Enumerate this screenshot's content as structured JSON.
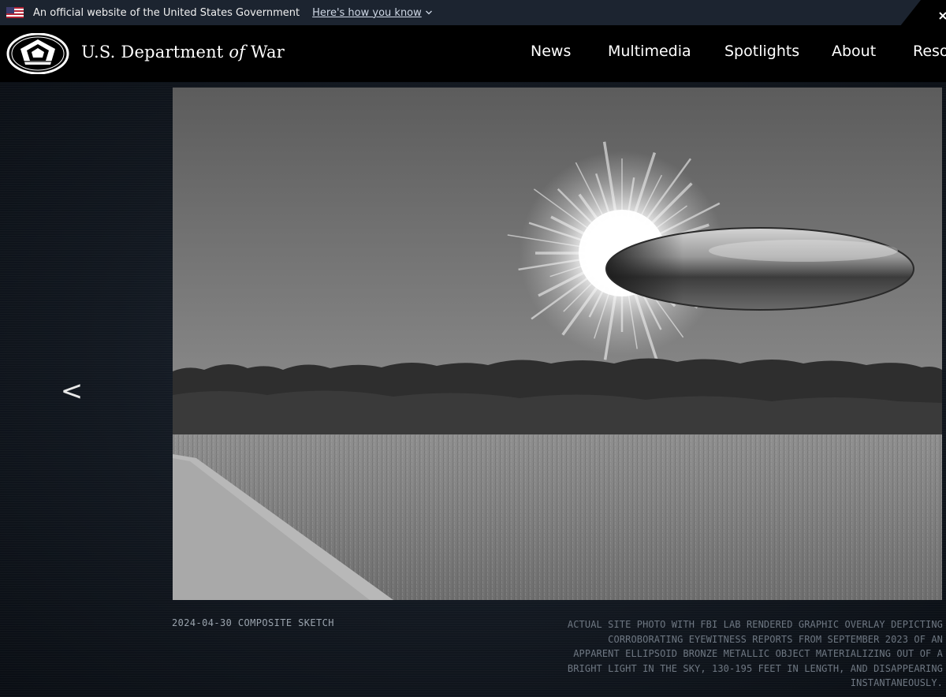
{
  "gov_banner": {
    "official_text": "An official website of the United States Government",
    "how_link": "Here's how you know",
    "flag_icon": "us-flag-icon"
  },
  "header": {
    "site_name_pre": "U.S. Department ",
    "site_name_of": "of",
    "site_name_post": " War",
    "nav": [
      {
        "label": "News"
      },
      {
        "label": "Multimedia"
      },
      {
        "label": "Spotlights"
      },
      {
        "label": "About"
      },
      {
        "label": "Resources"
      }
    ]
  },
  "gallery": {
    "prev_label": "<",
    "photo_icon": "ufo-composite-photo",
    "caption_left": "2024-04-30 COMPOSITE SKETCH",
    "caption_right": [
      "ACTUAL SITE PHOTO WITH FBI LAB RENDERED GRAPHIC OVERLAY DEPICTING",
      "CORROBORATING EYEWITNESS REPORTS FROM SEPTEMBER 2023 OF AN",
      "APPARENT ELLIPSOID BRONZE METALLIC OBJECT MATERIALIZING OUT OF A",
      "BRIGHT LIGHT IN THE SKY, 130-195 FEET IN LENGTH, AND DISAPPEARING",
      "INSTANTANEOUSLY."
    ]
  },
  "colors": {
    "banner_bg": "#1c2430",
    "header_bg": "#000000",
    "page_bg": "#121820",
    "caption_left": "#9aa3ad",
    "caption_right": "#6e7782"
  }
}
